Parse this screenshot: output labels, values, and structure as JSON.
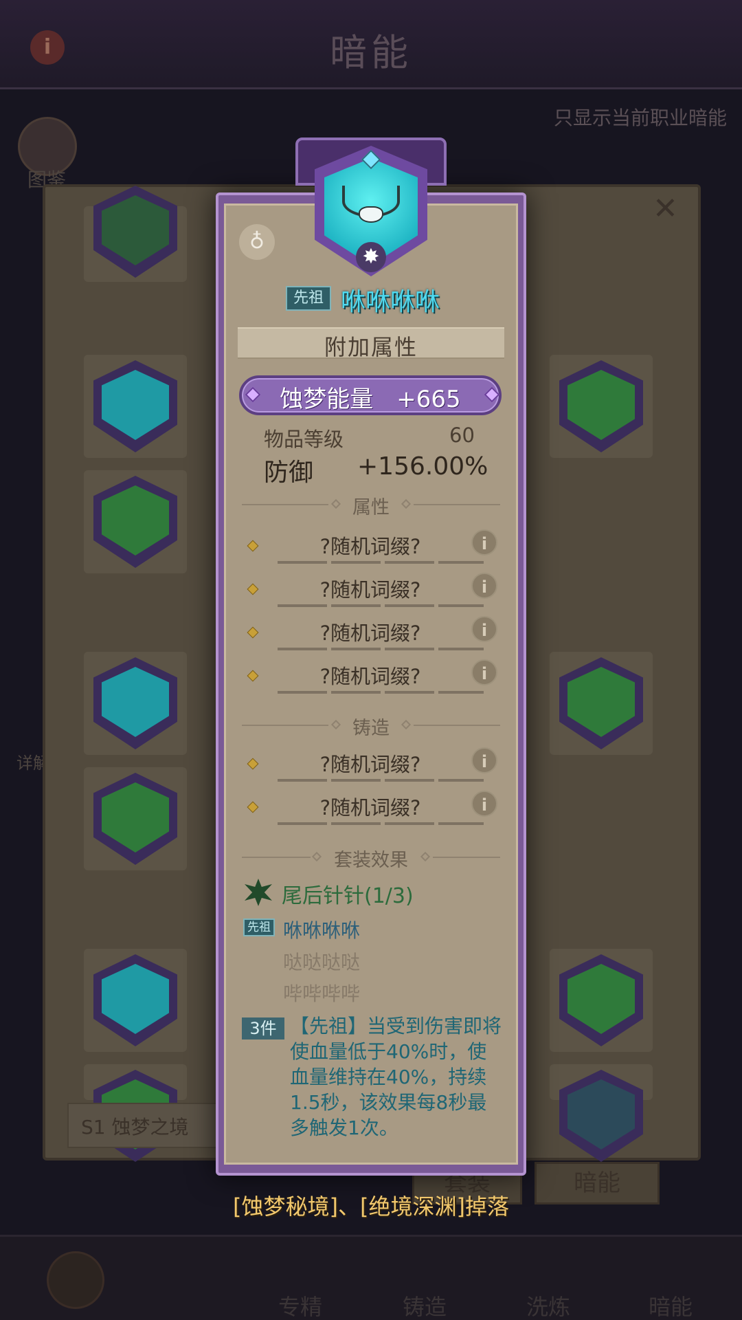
{
  "background": {
    "title": "暗能",
    "info_glyph": "i",
    "filter_label": "只显示当前职业暗能",
    "codex_label": "图鉴",
    "detail_label": "详解",
    "close_glyph": "✕",
    "season_label": "S1 蚀梦之境",
    "tab_set": "套装",
    "tab_dark_energy": "暗能",
    "nav": [
      "专精",
      "铸造",
      "洗炼",
      "暗能"
    ]
  },
  "item": {
    "rarity_tag": "先祖",
    "name": "咻咻咻咻",
    "name_color": "#4fd9ef",
    "icon": "necklace-icon",
    "type_icon": "amulet-type-icon",
    "star_glyph": "✸",
    "extra_section_title": "附加属性",
    "main_stat": "蚀梦能量　+665",
    "item_level_label": "物品等级",
    "item_level_value": "60",
    "defense_label": "防御",
    "defense_value": "+156.00%",
    "attr_section_title": "属性",
    "attributes": [
      "?随机词缀?",
      "?随机词缀?",
      "?随机词缀?",
      "?随机词缀?"
    ],
    "forge_section_title": "铸造",
    "forge_affixes": [
      "?随机词缀?",
      "?随机词缀?"
    ],
    "info_glyph": "i",
    "set_section_title": "套装效果",
    "set_name": "尾后针针(1/3)",
    "set_pieces": [
      {
        "tag": "先祖",
        "name": "咻咻咻咻",
        "owned": true
      },
      {
        "tag": "",
        "name": "哒哒哒哒",
        "owned": false
      },
      {
        "tag": "",
        "name": "哔哔哔哔",
        "owned": false
      }
    ],
    "set_bonus_tag": "3件",
    "set_bonus_text": "【先祖】当受到伤害即将使血量低于40%时，使血量维持在40%，持续1.5秒，该效果每8秒最多触发1次。"
  },
  "drop_source": "[蚀梦秘境]、[绝境深渊]掉落",
  "colors": {
    "accent_purple": "#8b6ab4",
    "ancestor_teal": "#2f5e66",
    "set_green": "#2c6b3c",
    "drop_gold": "#f2c86c"
  }
}
